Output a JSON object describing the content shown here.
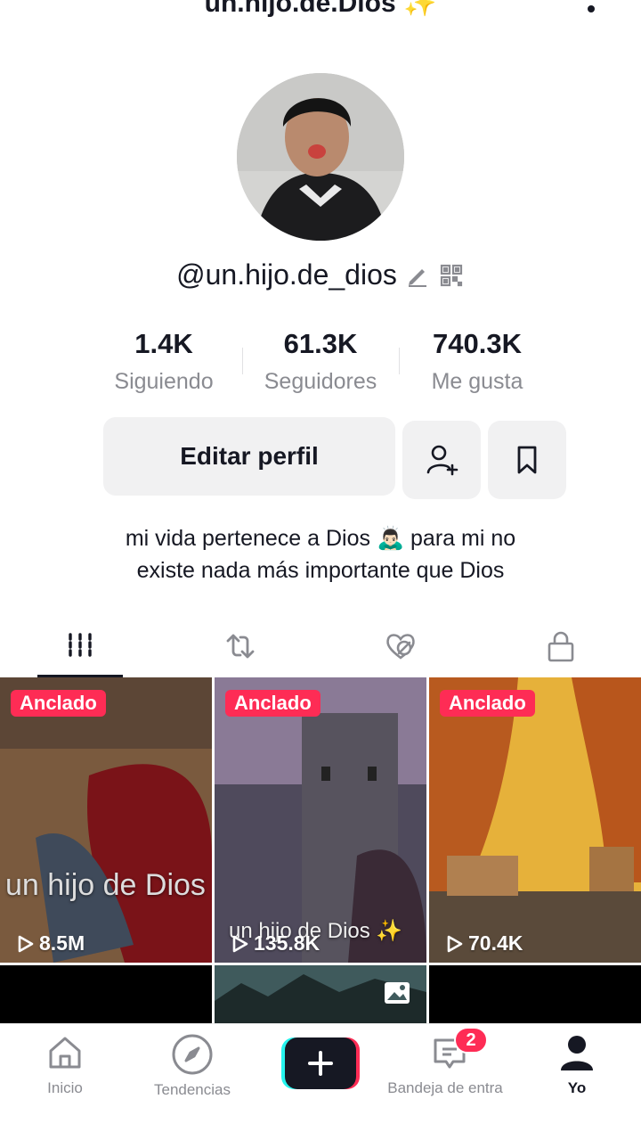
{
  "header": {
    "title": "un.hijo.de.Dios ✨"
  },
  "profile": {
    "username": "@un.hijo.de_dios",
    "stats": [
      {
        "value": "1.4K",
        "label": "Siguiendo"
      },
      {
        "value": "61.3K",
        "label": "Seguidores"
      },
      {
        "value": "740.3K",
        "label": "Me gusta"
      }
    ],
    "edit_button": "Editar perfil",
    "bio_line1": "mi vida pertenece a Dios 🙇🏻‍♂️ para mi no",
    "bio_line2": "existe nada más importante que Dios"
  },
  "videos": [
    {
      "pinned": "Anclado",
      "views": "8.5M",
      "overlay": "un hijo de Dios"
    },
    {
      "pinned": "Anclado",
      "views": "135.8K",
      "overlay": "un hijo de Dios ✨"
    },
    {
      "pinned": "Anclado",
      "views": "70.4K",
      "overlay": ""
    }
  ],
  "nav": {
    "home": "Inicio",
    "discover": "Tendencias",
    "inbox": "Bandeja de entra",
    "inbox_badge": "2",
    "me": "Yo"
  },
  "colors": {
    "accent": "#fe2c55",
    "text": "#161823",
    "muted": "#8a8b91"
  }
}
